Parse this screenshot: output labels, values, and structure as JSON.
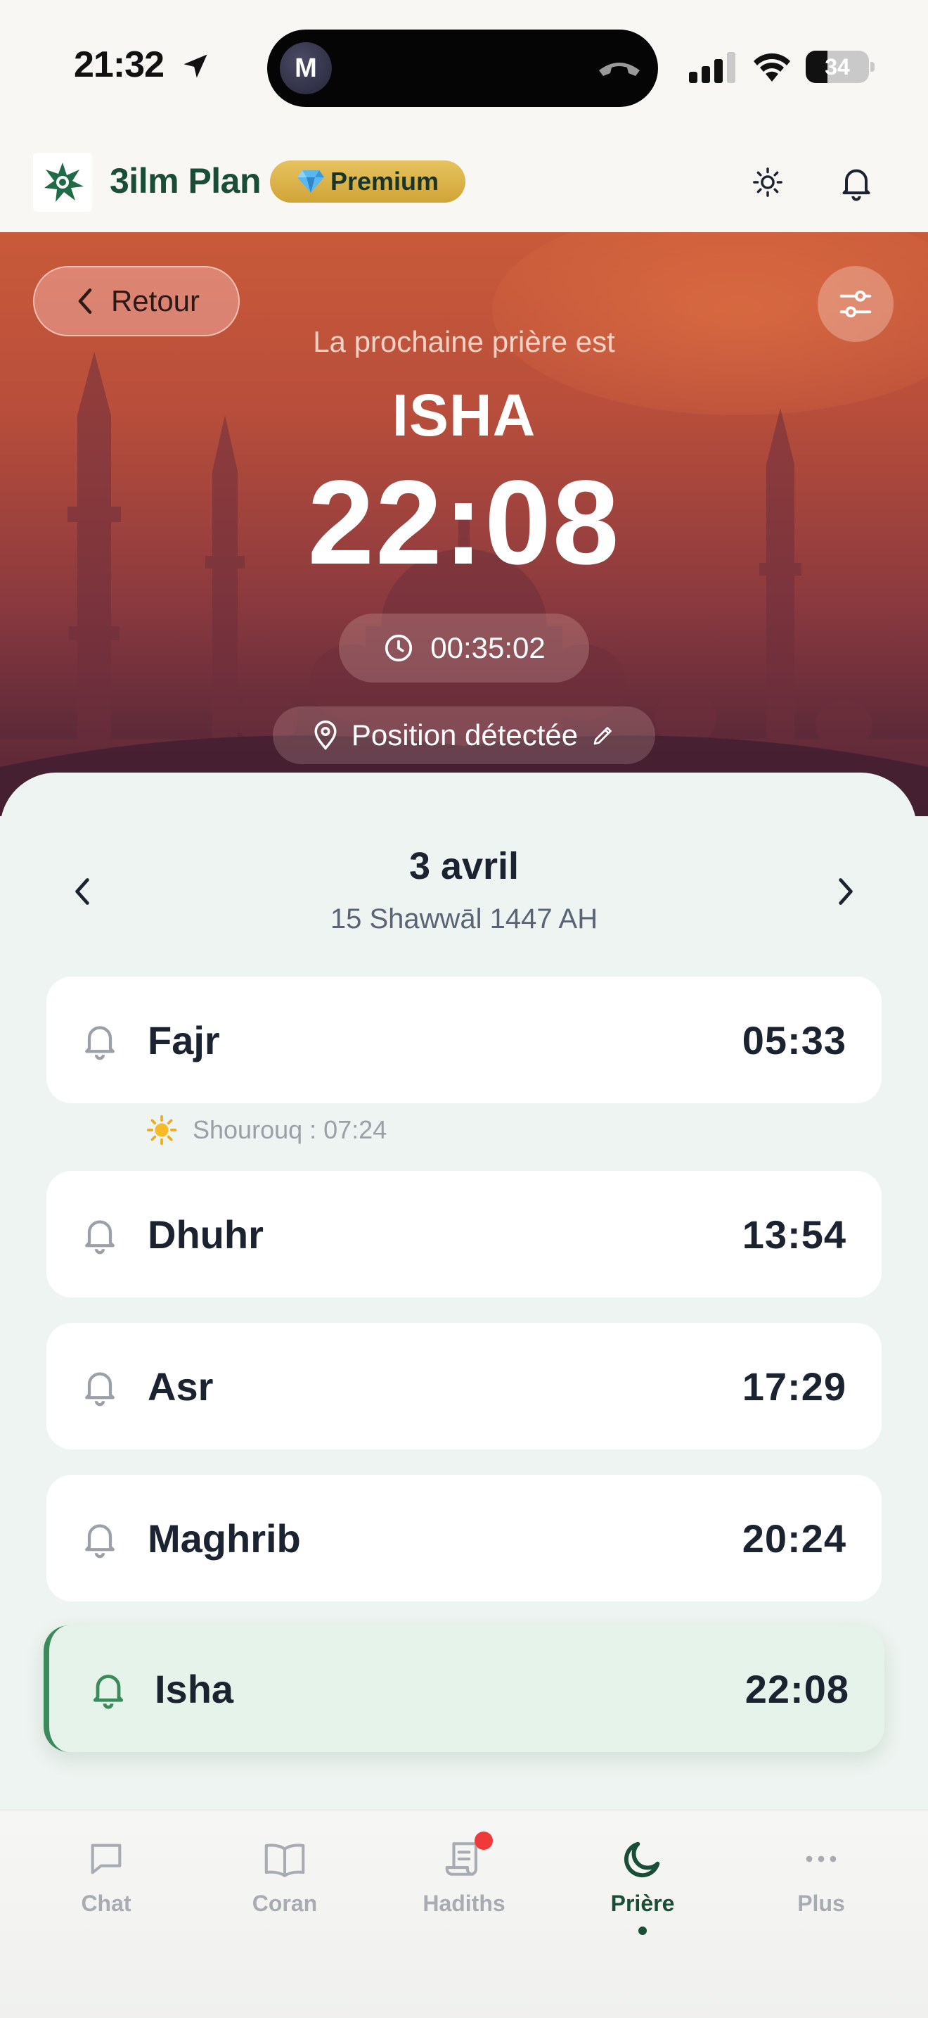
{
  "status_bar": {
    "time": "21:32",
    "island_avatar": "M",
    "battery": "34",
    "battery_level": 0.34
  },
  "header": {
    "app_name": "3ilm Plan",
    "premium_label": "Premium",
    "premium_icon": "gem-icon",
    "brand_color": "#1a4d36"
  },
  "hero": {
    "back_label": "Retour",
    "next_prayer_label": "La prochaine prière est",
    "next_prayer_name": "ISHA",
    "next_prayer_time": "22:08",
    "countdown": "00:35:02",
    "location": "Position détectée"
  },
  "date": {
    "gregorian": "3 avril",
    "hijri": "15 Shawwāl 1447 AH"
  },
  "prayers": [
    {
      "name": "Fajr",
      "time": "05:33"
    },
    {
      "name": "Dhuhr",
      "time": "13:54"
    },
    {
      "name": "Asr",
      "time": "17:29"
    },
    {
      "name": "Maghrib",
      "time": "20:24"
    },
    {
      "name": "Isha",
      "time": "22:08",
      "active": true
    }
  ],
  "sunrise": {
    "label": "Shourouq : 07:24",
    "icon": "sun-icon"
  },
  "tabs": [
    {
      "label": "Chat",
      "icon": "chat-icon"
    },
    {
      "label": "Coran",
      "icon": "book-icon"
    },
    {
      "label": "Hadiths",
      "icon": "scroll-icon",
      "badge": true
    },
    {
      "label": "Prière",
      "icon": "moon-icon",
      "active": true
    },
    {
      "label": "Plus",
      "icon": "more-icon"
    }
  ],
  "colors": {
    "accent_green": "#3a8a5c",
    "active_row_bg": "#e5f3ea",
    "badge_red": "#ef3a3a"
  }
}
